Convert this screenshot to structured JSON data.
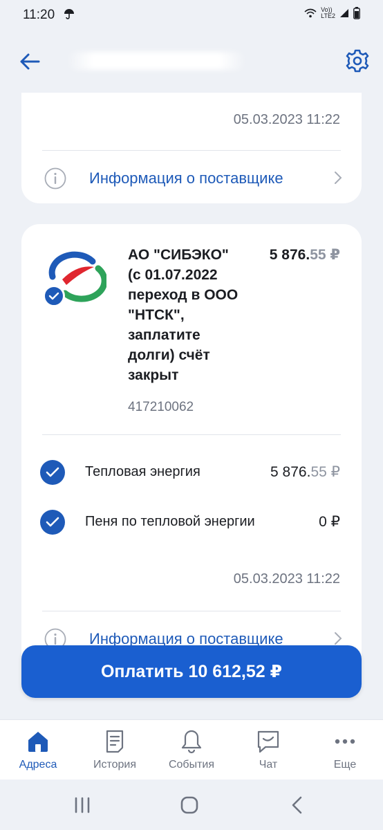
{
  "status_bar": {
    "time": "11:20",
    "network_top": "Vo))",
    "network_bottom": "LTE2"
  },
  "header": {
    "back_icon": "arrow-left-icon",
    "settings_icon": "gear-icon"
  },
  "card_top": {
    "date": "05.03.2023 11:22",
    "info_label": "Информация о поставщике"
  },
  "provider": {
    "name": "АО \"СИБЭКО\" (с 01.07.2022 переход в ООО \"НТСК\", заплатите долги) счёт закрыт",
    "account": "417210062",
    "amount_main": "5 876.",
    "amount_kop": "55 ₽",
    "services": [
      {
        "name": "Тепловая энергия",
        "amount_main": "5 876.",
        "amount_kop": "55 ₽"
      },
      {
        "name": "Пеня по тепловой энергии",
        "amount": "0 ₽"
      }
    ],
    "date": "05.03.2023 11:22",
    "info_label": "Информация о поставщике"
  },
  "pay_button": {
    "label": "Оплатить 10 612,52 ₽"
  },
  "bottom_nav": {
    "items": [
      {
        "label": "Адреса",
        "icon": "home-icon",
        "active": true
      },
      {
        "label": "История",
        "icon": "document-icon",
        "active": false
      },
      {
        "label": "События",
        "icon": "bell-icon",
        "active": false
      },
      {
        "label": "Чат",
        "icon": "chat-icon",
        "active": false
      },
      {
        "label": "Еще",
        "icon": "more-icon",
        "active": false
      }
    ]
  },
  "colors": {
    "accent": "#1e5ab8",
    "button": "#1a5fd0",
    "background": "#eef1f6"
  }
}
